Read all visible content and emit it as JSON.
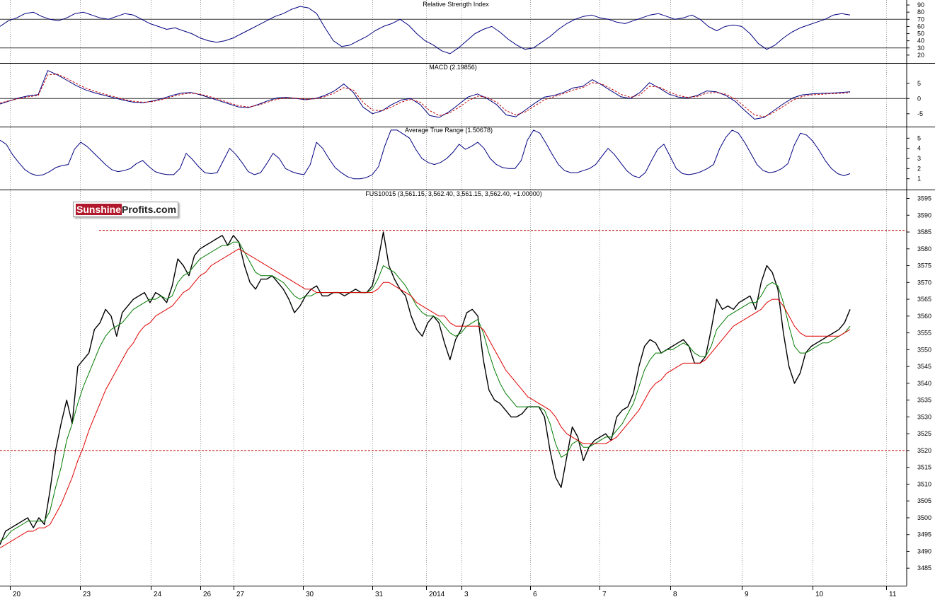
{
  "colors": {
    "price": "#000000",
    "ma_short": "#007a00",
    "ma_long": "#e00000",
    "indicator": "#000080",
    "signal": "#c00000",
    "level": "#c00000",
    "grid": "#9a9a9a"
  },
  "logo": {
    "part1": "Sunshine",
    "part2": "Profits.com"
  },
  "chart_data": [
    {
      "type": "line",
      "title": "Relative Strength Index",
      "yticks": [
        20,
        30,
        40,
        50,
        60,
        70,
        80,
        90
      ],
      "ylim": [
        10,
        95
      ],
      "reference_lines": [
        30,
        70
      ],
      "series": [
        {
          "values": [
            60,
            68,
            72,
            78,
            80,
            74,
            70,
            68,
            72,
            78,
            80,
            76,
            72,
            70,
            74,
            78,
            76,
            70,
            64,
            60,
            56,
            58,
            54,
            50,
            44,
            40,
            38,
            40,
            44,
            50,
            56,
            62,
            68,
            74,
            78,
            84,
            88,
            86,
            78,
            58,
            40,
            32,
            34,
            40,
            46,
            54,
            60,
            64,
            70,
            62,
            50,
            40,
            34,
            26,
            22,
            30,
            40,
            50,
            56,
            60,
            52,
            42,
            34,
            28,
            30,
            38,
            46,
            56,
            64,
            70,
            74,
            76,
            72,
            70,
            66,
            64,
            68,
            72,
            76,
            78,
            74,
            70,
            72,
            76,
            70,
            60,
            54,
            60,
            62,
            60,
            50,
            36,
            28,
            34,
            44,
            52,
            58,
            62,
            66,
            70,
            76,
            78,
            76
          ]
        }
      ]
    },
    {
      "type": "line",
      "title": "MACD (2.19856)",
      "yticks": [
        -5,
        0,
        5
      ],
      "ylim": [
        -9,
        11
      ],
      "reference_lines": [
        0
      ],
      "series": [
        {
          "values": [
            -1.8,
            -0.8,
            0.2,
            0.9,
            1.3,
            9.2,
            7.8,
            6.0,
            4.2,
            2.8,
            1.8,
            1.0,
            0.2,
            -0.6,
            -1.2,
            -1.4,
            -0.8,
            0.0,
            1.0,
            1.8,
            2.0,
            1.2,
            0.2,
            -0.8,
            -1.8,
            -2.8,
            -3.0,
            -2.0,
            -0.8,
            0.2,
            0.4,
            0.0,
            -0.4,
            0.0,
            1.0,
            2.5,
            4.8,
            2.0,
            -2.8,
            -5.0,
            -4.0,
            -2.0,
            -0.5,
            0.0,
            -2.0,
            -5.6,
            -6.2,
            -4.4,
            -2.0,
            0.5,
            1.5,
            0.0,
            -2.0,
            -5.4,
            -6.0,
            -3.8,
            -1.5,
            0.5,
            1.0,
            2.0,
            3.5,
            4.0,
            6.2,
            4.5,
            2.5,
            0.6,
            0.0,
            2.0,
            5.2,
            3.5,
            1.5,
            0.5,
            0.2,
            1.0,
            2.5,
            2.2,
            1.0,
            -1.0,
            -4.0,
            -6.8,
            -6.2,
            -4.0,
            -1.8,
            0.2,
            1.2,
            1.5,
            1.7,
            1.8,
            2.0,
            2.2
          ]
        },
        {
          "values": [
            -1.5,
            -0.7,
            0.0,
            0.6,
            1.0,
            7.8,
            8.0,
            6.6,
            4.9,
            3.4,
            2.3,
            1.4,
            0.6,
            -0.3,
            -0.9,
            -1.2,
            -1.0,
            -0.3,
            0.6,
            1.4,
            1.8,
            1.4,
            0.6,
            -0.4,
            -1.4,
            -2.4,
            -2.8,
            -2.2,
            -1.2,
            -0.2,
            0.2,
            0.1,
            -0.2,
            -0.1,
            0.6,
            1.8,
            3.6,
            2.8,
            -1.2,
            -3.8,
            -4.0,
            -2.8,
            -1.2,
            -0.3,
            -1.2,
            -4.0,
            -5.6,
            -4.8,
            -3.0,
            -0.8,
            0.8,
            0.4,
            -1.2,
            -4.0,
            -5.4,
            -4.4,
            -2.4,
            -0.4,
            0.6,
            1.6,
            2.8,
            3.6,
            5.2,
            4.8,
            3.2,
            1.4,
            0.4,
            1.2,
            4.0,
            3.8,
            2.2,
            1.0,
            0.4,
            0.7,
            1.8,
            2.0,
            1.4,
            -0.2,
            -2.8,
            -5.4,
            -6.0,
            -4.6,
            -2.6,
            -0.6,
            0.7,
            1.2,
            1.4,
            1.6,
            1.7,
            1.9
          ]
        }
      ]
    },
    {
      "type": "line",
      "title": "Average True Range (1.50678)",
      "yticks": [
        1,
        2,
        3,
        4,
        5
      ],
      "ylim": [
        0,
        6
      ],
      "series": [
        {
          "values": [
            4.8,
            4.4,
            3.4,
            2.6,
            1.9,
            1.5,
            1.3,
            1.4,
            1.7,
            2.1,
            2.3,
            2.4,
            3.9,
            4.6,
            4.2,
            3.6,
            3.0,
            2.4,
            1.9,
            1.7,
            1.8,
            2.0,
            2.5,
            2.8,
            2.2,
            1.7,
            1.5,
            1.4,
            1.4,
            2.0,
            3.5,
            2.9,
            2.2,
            1.6,
            1.5,
            1.6,
            2.8,
            4.0,
            3.4,
            2.6,
            1.7,
            1.4,
            1.6,
            2.5,
            3.5,
            3.0,
            2.0,
            1.7,
            1.5,
            1.4,
            2.4,
            4.6,
            4.0,
            3.0,
            2.1,
            1.6,
            1.2,
            1.0,
            1.0,
            1.1,
            1.4,
            2.2,
            4.2,
            5.8,
            5.8,
            5.4,
            5.0,
            3.9,
            3.0,
            2.6,
            2.4,
            2.6,
            3.0,
            3.6,
            4.4,
            3.9,
            4.2,
            4.6,
            4.0,
            3.0,
            2.4,
            2.1,
            2.0,
            2.0,
            2.8,
            4.8,
            5.8,
            5.5,
            4.5,
            3.4,
            2.4,
            1.8,
            1.6,
            1.6,
            1.8,
            2.0,
            2.4,
            3.2,
            4.0,
            3.4,
            2.6,
            1.8,
            1.3,
            1.1,
            1.6,
            2.8,
            3.9,
            4.4,
            3.2,
            2.0,
            1.5,
            1.4,
            1.5,
            1.7,
            2.0,
            2.4,
            4.0,
            5.1,
            5.8,
            5.5,
            4.6,
            3.5,
            2.4,
            1.8,
            1.6,
            1.7,
            2.0,
            2.5,
            4.3,
            5.5,
            5.3,
            4.7,
            3.8,
            2.8,
            2.0,
            1.5,
            1.3,
            1.5
          ]
        }
      ]
    },
    {
      "type": "line",
      "title": "FUS10015 (3,561.15, 3,562.40, 3,561.15, 3,562.40, +1.00000)",
      "yticks": [
        3485,
        3490,
        3495,
        3500,
        3505,
        3510,
        3515,
        3520,
        3525,
        3530,
        3535,
        3540,
        3545,
        3550,
        3555,
        3560,
        3565,
        3570,
        3575,
        3580,
        3585,
        3590,
        3595
      ],
      "ylim": [
        3480,
        3597
      ],
      "reference_lines": [
        3585.5,
        3520
      ],
      "categories": [
        "20",
        "23",
        "24",
        "26",
        "27",
        "30",
        "31",
        "2014",
        "3",
        "6",
        "7",
        "8",
        "9",
        "10",
        "11"
      ],
      "series": [
        {
          "values": [
            3492,
            3496,
            3497,
            3498,
            3499,
            3500,
            3497,
            3500,
            3498,
            3508,
            3520,
            3528,
            3535,
            3528,
            3545,
            3547,
            3549,
            3556,
            3558,
            3562,
            3560,
            3554,
            3561,
            3563,
            3565,
            3566,
            3567,
            3564,
            3567,
            3566,
            3564,
            3569,
            3577,
            3575,
            3572,
            3578,
            3580,
            3581,
            3582,
            3583,
            3584,
            3581,
            3584,
            3582,
            3575,
            3570,
            3568,
            3571,
            3571,
            3572,
            3570,
            3568,
            3565,
            3561,
            3563,
            3566,
            3568,
            3569,
            3566,
            3566,
            3567,
            3567,
            3566,
            3567,
            3568,
            3567,
            3567,
            3569,
            3576,
            3585,
            3575,
            3571,
            3568,
            3566,
            3560,
            3556,
            3554,
            3558,
            3560,
            3558,
            3552,
            3547,
            3553,
            3556,
            3561,
            3562,
            3560,
            3547,
            3538,
            3535,
            3534,
            3532,
            3530,
            3530,
            3531,
            3533,
            3533,
            3533,
            3530,
            3520,
            3512,
            3509,
            3518,
            3527,
            3524,
            3517,
            3521,
            3523,
            3524,
            3525,
            3523,
            3530,
            3532,
            3533,
            3537,
            3545,
            3551,
            3553,
            3552,
            3549,
            3550,
            3551,
            3552,
            3553,
            3551,
            3546,
            3546,
            3548,
            3556,
            3565,
            3562,
            3563,
            3562,
            3564,
            3565,
            3566,
            3562,
            3570,
            3575,
            3573,
            3568,
            3555,
            3545,
            3540,
            3543,
            3549,
            3551,
            3552,
            3553,
            3554,
            3555,
            3556,
            3558,
            3562
          ]
        },
        {
          "values": [
            3493,
            3494,
            3496,
            3497,
            3498,
            3499,
            3499,
            3499,
            3499,
            3502,
            3509,
            3515,
            3523,
            3528,
            3534,
            3539,
            3543,
            3547,
            3551,
            3554,
            3556,
            3557,
            3558,
            3560,
            3562,
            3563,
            3564,
            3565,
            3565,
            3566,
            3565,
            3566,
            3570,
            3572,
            3573,
            3575,
            3577,
            3578,
            3579,
            3580,
            3581,
            3581,
            3582,
            3582,
            3579,
            3576,
            3573,
            3572,
            3572,
            3572,
            3571,
            3570,
            3568,
            3566,
            3565,
            3566,
            3566,
            3567,
            3567,
            3567,
            3567,
            3567,
            3567,
            3567,
            3567,
            3567,
            3567,
            3568,
            3571,
            3575,
            3574,
            3573,
            3571,
            3569,
            3566,
            3563,
            3561,
            3560,
            3560,
            3559,
            3557,
            3555,
            3554,
            3555,
            3557,
            3558,
            3559,
            3555,
            3549,
            3544,
            3540,
            3537,
            3535,
            3533,
            3533,
            3533,
            3533,
            3533,
            3532,
            3528,
            3522,
            3518,
            3519,
            3522,
            3523,
            3521,
            3521,
            3522,
            3523,
            3524,
            3524,
            3526,
            3528,
            3531,
            3534,
            3539,
            3544,
            3547,
            3549,
            3549,
            3550,
            3550,
            3551,
            3552,
            3551,
            3549,
            3548,
            3548,
            3551,
            3556,
            3558,
            3560,
            3561,
            3562,
            3563,
            3564,
            3564,
            3566,
            3569,
            3570,
            3569,
            3564,
            3557,
            3551,
            3549,
            3549,
            3550,
            3551,
            3552,
            3552,
            3553,
            3554,
            3555,
            3557
          ]
        },
        {
          "values": [
            3491,
            3492,
            3493,
            3494,
            3495,
            3496,
            3496,
            3497,
            3497,
            3498,
            3501,
            3504,
            3508,
            3512,
            3517,
            3521,
            3526,
            3530,
            3534,
            3538,
            3541,
            3544,
            3547,
            3550,
            3552,
            3555,
            3557,
            3558,
            3560,
            3561,
            3562,
            3563,
            3565,
            3567,
            3568,
            3570,
            3572,
            3573,
            3575,
            3576,
            3577,
            3578,
            3579,
            3580,
            3579,
            3578,
            3577,
            3576,
            3575,
            3574,
            3573,
            3572,
            3571,
            3570,
            3569,
            3568,
            3568,
            3567,
            3567,
            3567,
            3567,
            3567,
            3567,
            3567,
            3567,
            3567,
            3567,
            3567,
            3568,
            3570,
            3570,
            3569,
            3568,
            3567,
            3566,
            3564,
            3563,
            3562,
            3561,
            3560,
            3560,
            3558,
            3557,
            3557,
            3557,
            3557,
            3557,
            3556,
            3553,
            3550,
            3547,
            3544,
            3542,
            3540,
            3538,
            3536,
            3535,
            3534,
            3533,
            3532,
            3530,
            3527,
            3525,
            3524,
            3523,
            3522,
            3522,
            3522,
            3522,
            3522,
            3523,
            3524,
            3526,
            3528,
            3530,
            3532,
            3535,
            3538,
            3540,
            3541,
            3543,
            3544,
            3545,
            3546,
            3546,
            3546,
            3546,
            3547,
            3549,
            3551,
            3553,
            3555,
            3557,
            3558,
            3559,
            3560,
            3561,
            3562,
            3564,
            3565,
            3565,
            3563,
            3560,
            3557,
            3555,
            3554,
            3554,
            3554,
            3554,
            3554,
            3554,
            3554,
            3555,
            3556
          ]
        }
      ]
    }
  ]
}
